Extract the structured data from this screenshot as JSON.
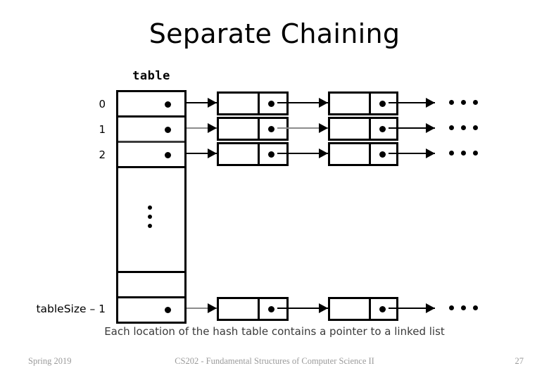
{
  "slide": {
    "title": "Separate Chaining",
    "caption": "Each location of the hash table contains a pointer to a linked list"
  },
  "diagram": {
    "array_label": "table",
    "array_label_font": "monospace",
    "vertical_ellipsis": "⋮",
    "horizontal_ellipsis": "···",
    "rows": [
      {
        "index_label": "0",
        "has_pointer": true,
        "line_color": "#000000",
        "nodes": [
          {
            "data_cell": "",
            "pointer_dot": true
          },
          {
            "data_cell": "",
            "pointer_dot": true
          }
        ],
        "trailing_ellipsis": true
      },
      {
        "index_label": "1",
        "has_pointer": true,
        "line_color": "#8c8c8c",
        "nodes": [
          {
            "data_cell": "",
            "pointer_dot": true
          },
          {
            "data_cell": "",
            "pointer_dot": true
          }
        ],
        "trailing_ellipsis": true
      },
      {
        "index_label": "2",
        "has_pointer": true,
        "line_color": "#000000",
        "nodes": [
          {
            "data_cell": "",
            "pointer_dot": true
          },
          {
            "data_cell": "",
            "pointer_dot": true
          }
        ],
        "trailing_ellipsis": true
      },
      {
        "index_label": "",
        "has_pointer": false,
        "line_color": "#000000",
        "nodes": [],
        "trailing_ellipsis": false
      },
      {
        "index_label": "",
        "has_pointer": false,
        "line_color": "#000000",
        "nodes": [],
        "trailing_ellipsis": false
      },
      {
        "index_label": "tableSize – 1",
        "has_pointer": true,
        "line_color": "#8c8c8c",
        "nodes": [
          {
            "data_cell": "",
            "pointer_dot": true
          },
          {
            "data_cell": "",
            "pointer_dot": true
          }
        ],
        "trailing_ellipsis": true
      }
    ]
  },
  "footer": {
    "left": "Spring 2019",
    "center": "CS202 - Fundamental Structures of Computer Science II",
    "right": "27"
  },
  "colors": {
    "ink": "#000000",
    "background": "#ffffff",
    "light_line": "#8c8c8c",
    "caption_text": "#3a3a3a",
    "footer_text": "#9a9a9a"
  }
}
